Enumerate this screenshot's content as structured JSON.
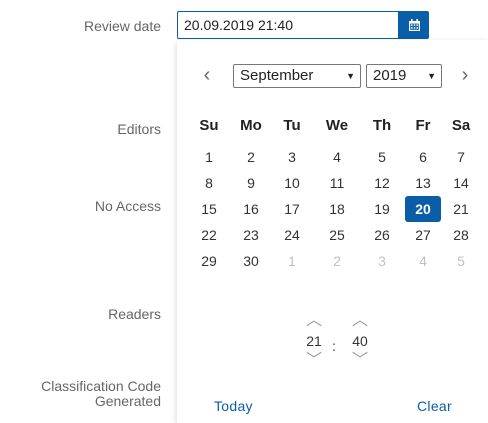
{
  "labels": {
    "review_date": "Review date",
    "editors": "Editors",
    "no_access": "No Access",
    "readers": "Readers",
    "classification_line1": "Classification Code",
    "classification_line2": "Generated"
  },
  "review_date_input": {
    "value": "20.09.2019 21:40",
    "icon": "calendar-icon"
  },
  "calendar": {
    "prev_icon": "‹",
    "next_icon": "›",
    "month": "September",
    "year": "2019",
    "weekdays": [
      "Su",
      "Mo",
      "Tu",
      "We",
      "Th",
      "Fr",
      "Sa"
    ],
    "weeks": [
      [
        "1",
        "2",
        "3",
        "4",
        "5",
        "6",
        "7"
      ],
      [
        "8",
        "9",
        "10",
        "11",
        "12",
        "13",
        "14"
      ],
      [
        "15",
        "16",
        "17",
        "18",
        "19",
        "20",
        "21"
      ],
      [
        "22",
        "23",
        "24",
        "25",
        "26",
        "27",
        "28"
      ],
      [
        "29",
        "30",
        "1",
        "2",
        "3",
        "4",
        "5"
      ]
    ],
    "selected_day": "20",
    "time": {
      "hour": "21",
      "separator": ":",
      "minute": "40"
    },
    "today_label": "Today",
    "clear_label": "Clear"
  },
  "colors": {
    "accent": "#0a5ea8",
    "muted_day": "#c2c2c2"
  }
}
